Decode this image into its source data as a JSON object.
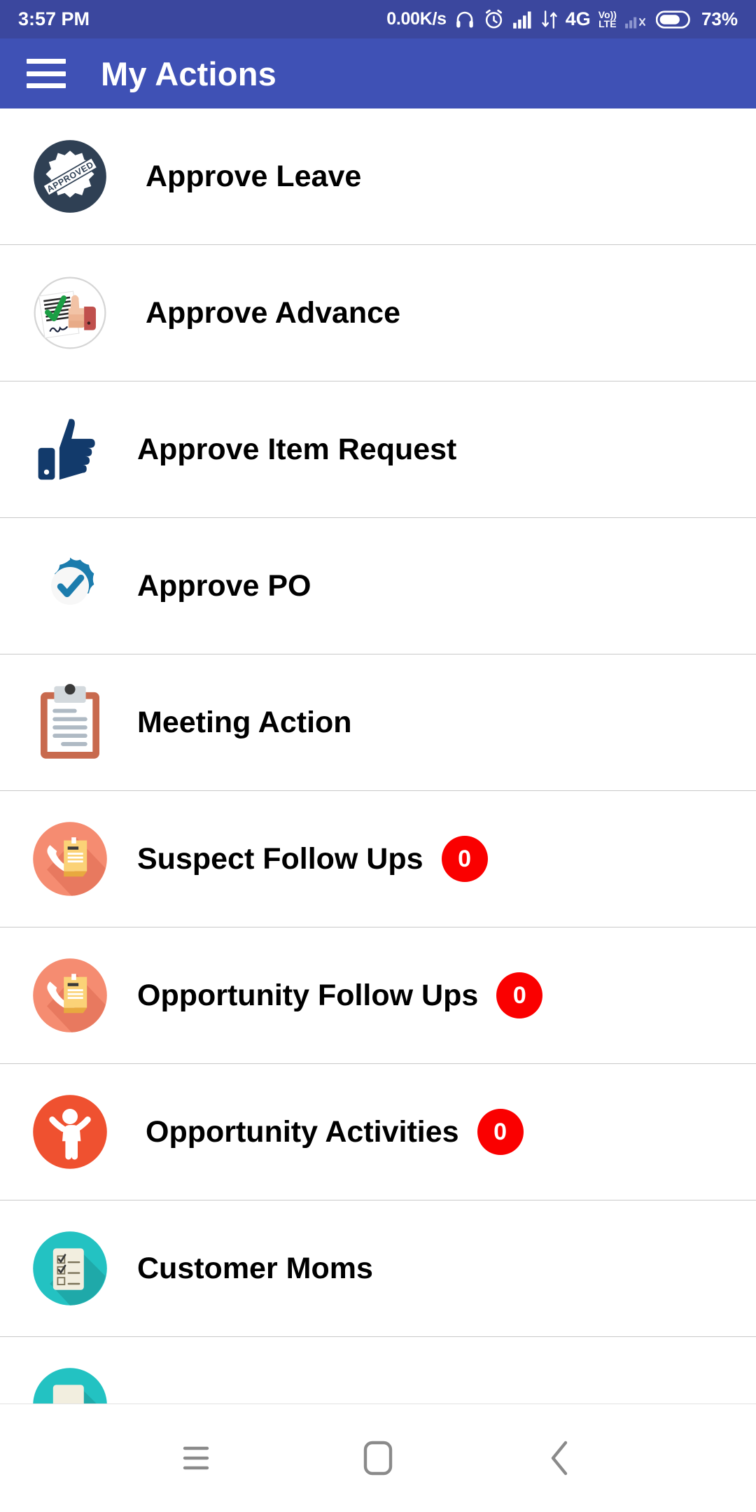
{
  "status_bar": {
    "time": "3:57 PM",
    "net_speed": "0.00K/s",
    "icons": [
      "headphones-icon",
      "alarm-clock-icon",
      "signal-bars-icon",
      "data-transfer-icon"
    ],
    "network_type": "4G",
    "volte_top": "Vo))",
    "volte_bottom": "LTE",
    "sim2_state": "no-service-x",
    "battery_percent": "73%"
  },
  "app_bar": {
    "menu_icon": "hamburger-menu-icon",
    "title": "My Actions"
  },
  "list": {
    "items": [
      {
        "label": "Approve Leave",
        "icon": "approved-stamp-icon",
        "badge": null
      },
      {
        "label": "Approve Advance",
        "icon": "thumbs-up-document-icon",
        "badge": null
      },
      {
        "label": "Approve Item Request",
        "icon": "thumbs-up-icon",
        "badge": null
      },
      {
        "label": "Approve PO",
        "icon": "verified-badge-icon",
        "badge": null
      },
      {
        "label": "Meeting Action",
        "icon": "clipboard-icon",
        "badge": null
      },
      {
        "label": "Suspect Follow Ups",
        "icon": "phone-note-icon",
        "badge": "0"
      },
      {
        "label": "Opportunity Follow Ups",
        "icon": "phone-note-icon",
        "badge": "0"
      },
      {
        "label": "Opportunity Activities",
        "icon": "person-raised-arms-icon",
        "badge": "0"
      },
      {
        "label": "Customer Moms",
        "icon": "checklist-icon",
        "badge": null
      }
    ]
  },
  "nav_bar": {
    "recents_label": "recents-icon",
    "home_label": "home-icon",
    "back_label": "back-icon"
  },
  "colors": {
    "status_bar_bg": "#3B479E",
    "app_bar_bg": "#3F51B5",
    "badge_bg": "#FA0000",
    "divider": "#c9c9c9"
  }
}
